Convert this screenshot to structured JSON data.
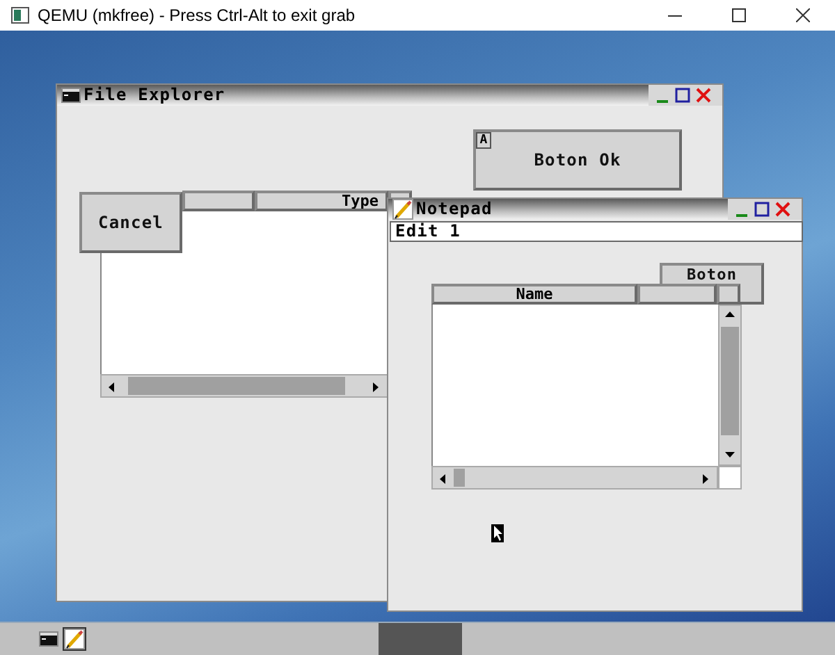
{
  "host_window": {
    "title": "QEMU (mkfree) - Press Ctrl-Alt to exit grab"
  },
  "file_explorer": {
    "title": "File Explorer",
    "ok_button": {
      "label": "Boton Ok",
      "hotkey": "A"
    },
    "list": {
      "column_2": "Type"
    },
    "cancel_button": {
      "label": "Cancel"
    }
  },
  "notepad": {
    "title": "Notepad",
    "edit_field": {
      "value": "Edit 1"
    },
    "button": {
      "label": "Boton"
    },
    "list": {
      "column_1": "Name"
    }
  },
  "taskbar": {
    "items": [
      {
        "kind": "terminal",
        "selected": false
      },
      {
        "kind": "notepad",
        "selected": true
      }
    ]
  }
}
